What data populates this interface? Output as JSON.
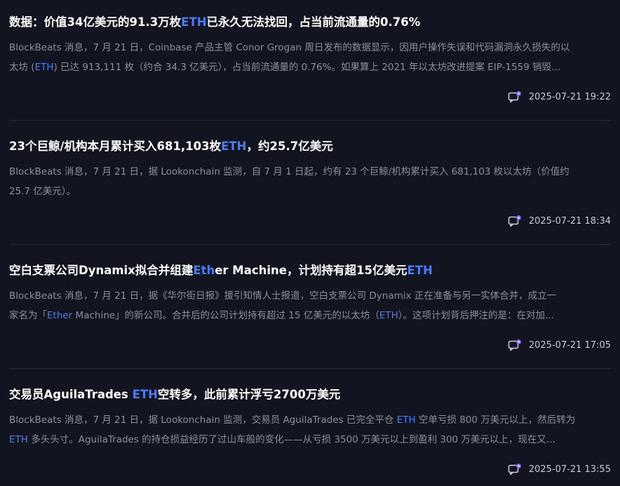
{
  "articles": [
    {
      "title": {
        "pre": "数据：价值34亿美元的91.3万枚",
        "hl": "ETH",
        "post": "已永久无法找回，占当前流通量的0.76%"
      },
      "line1": {
        "text": "BlockBeats 消息，7 月 21 日，Coinbase 产品主管 Conor Grogan 周日发布的数据显示，因用户操作失误和代码漏洞永久损失的以"
      },
      "line2": {
        "pre": "太坊 (",
        "hl": "ETH",
        "post": ") 已达 913,111 枚（约合 34.3 亿美元），占当前流通量的 0.76%。如果算上 2021 年以太坊改进提案 EIP-1559 销毁..."
      },
      "time": "2025-07-21 19:22"
    },
    {
      "title": {
        "pre": "23个巨鲸/机构本月累计买入681,103枚",
        "hl": "ETH",
        "post": "，约25.7亿美元"
      },
      "line1": {
        "text": "BlockBeats 消息，7 月 21 日，据 Lookonchain 监测，自 7 月 1 日起，约有 23 个巨鲸/机构累计买入 681,103 枚以太坊（价值约"
      },
      "line2": {
        "pre": "25.7 亿美元）。",
        "hl": "",
        "post": ""
      },
      "time": "2025-07-21 18:34"
    },
    {
      "title": {
        "pre": "空白支票公司Dynamix拟合并组建",
        "hl": "Eth",
        "post": "er Machine，计划持有超15亿美元",
        "hl2": "ETH"
      },
      "line1": {
        "text": "BlockBeats 消息，7 月 21 日，据《华尔街日报》援引知情人士报道，空白支票公司 Dynamix 正在准备与另一实体合并，成立一"
      },
      "line2": {
        "pre": "家名为「",
        "hl": "Ether",
        "post": " Machine」的新公司。合并后的公司计划持有超过 15 亿美元的以太坊（",
        "hl2": "ETH",
        "post2": "）。这项计划背后押注的是：在对加..."
      },
      "time": "2025-07-21 17:05"
    },
    {
      "title": {
        "pre": "交易员AguilaTrades ",
        "hl": "ETH",
        "post": "空转多，此前累计浮亏2700万美元"
      },
      "line1": {
        "pre": "BlockBeats 消息，7 月 21 日，据 Lookonchain 监测，交易员 AguilaTrades 已完全平仓 ",
        "hl": "ETH",
        "post": " 空单亏损 800 万美元以上，然后转为"
      },
      "line2": {
        "pre": "",
        "hl": "ETH",
        "post": " 多头头寸。AguilaTrades 的持仓损益经历了过山车般的变化——从亏损 3500 万美元以上到盈利 300 万美元以上，现在又..."
      },
      "time": "2025-07-21 13:55"
    }
  ],
  "colors": {
    "background": "#12141f",
    "title": "#ffffff",
    "summary": "#8c8f9c",
    "highlight": "#4d7cf2",
    "divider": "#262a3a"
  }
}
